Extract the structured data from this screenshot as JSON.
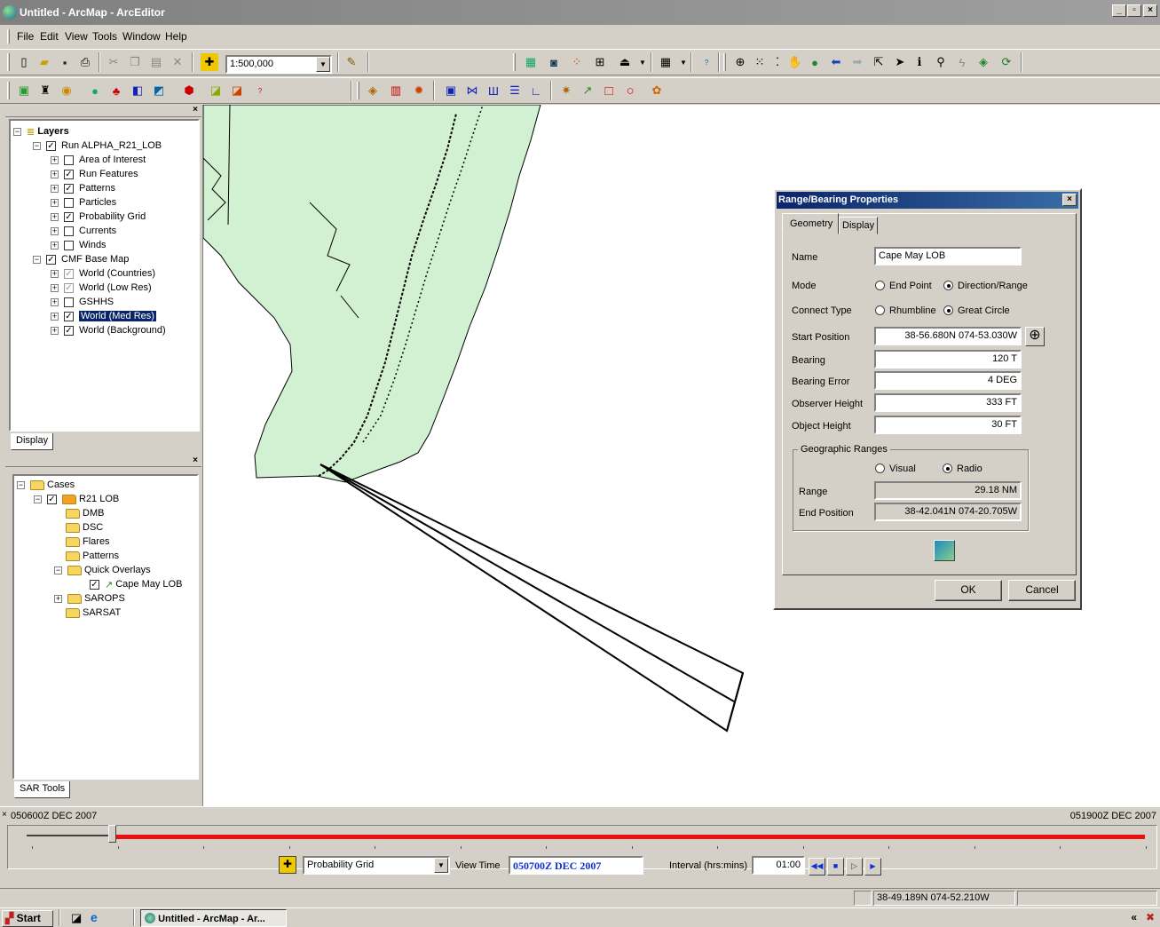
{
  "window": {
    "title": "Untitled - ArcMap - ArcEditor",
    "min": "_",
    "max": "▫",
    "close": "×"
  },
  "menu": [
    "File",
    "Edit",
    "View",
    "Tools",
    "Window",
    "Help"
  ],
  "toolbar": {
    "scale": "1:500,000"
  },
  "layers_panel": {
    "root": "Layers",
    "groups": [
      {
        "name": "Run ALPHA_R21_LOB",
        "checked": true,
        "items": [
          {
            "name": "Area of Interest",
            "checked": false
          },
          {
            "name": "Run Features",
            "checked": true
          },
          {
            "name": "Patterns",
            "checked": true
          },
          {
            "name": "Particles",
            "checked": false
          },
          {
            "name": "Probability Grid",
            "checked": true
          },
          {
            "name": "Currents",
            "checked": false
          },
          {
            "name": "Winds",
            "checked": false
          }
        ]
      },
      {
        "name": "CMF Base Map",
        "checked": true,
        "items": [
          {
            "name": "World (Countries)",
            "checked": "grey"
          },
          {
            "name": "World (Low Res)",
            "checked": "grey"
          },
          {
            "name": "GSHHS",
            "checked": false
          },
          {
            "name": "World (Med Res)",
            "checked": true,
            "selected": true
          },
          {
            "name": "World (Background)",
            "checked": true
          }
        ]
      }
    ],
    "tab": "Display"
  },
  "cases_panel": {
    "root": "Cases",
    "case": "R21 LOB",
    "children": [
      "DMB",
      "DSC",
      "Flares",
      "Patterns",
      "Quick Overlays",
      "SAROPS",
      "SARSAT"
    ],
    "overlay_item": "Cape May LOB",
    "tab": "SAR Tools"
  },
  "dialog": {
    "title": "Range/Bearing Properties",
    "tabs": [
      "Geometry",
      "Display"
    ],
    "name_label": "Name",
    "name_value": "Cape May LOB",
    "mode_label": "Mode",
    "mode_options": [
      "End Point",
      "Direction/Range"
    ],
    "connect_label": "Connect Type",
    "connect_options": [
      "Rhumbline",
      "Great Circle"
    ],
    "start_label": "Start Position",
    "start_value": "38-56.680N 074-53.030W",
    "bearing_label": "Bearing",
    "bearing_value": "120 T",
    "bearing_error_label": "Bearing Error",
    "bearing_error_value": "4 DEG",
    "observer_label": "Observer Height",
    "observer_value": "333 FT",
    "object_label": "Object Height",
    "object_value": "30 FT",
    "geo_group": "Geographic Ranges",
    "geo_options": [
      "Visual",
      "Radio"
    ],
    "range_label": "Range",
    "range_value": "29.18 NM",
    "end_label": "End Position",
    "end_value": "38-42.041N 074-20.705W",
    "ok": "OK",
    "cancel": "Cancel"
  },
  "timebar": {
    "start": "050600Z DEC 2007",
    "end": "051900Z DEC 2007",
    "layer": "Probability Grid",
    "view_time_label": "View Time",
    "view_time": "050700Z DEC 2007",
    "interval_label": "Interval (hrs:mins)",
    "interval": "01:00",
    "progress_fraction": 0.077
  },
  "status": {
    "coords": "38-49.189N 074-52.210W"
  },
  "taskbar": {
    "start": "Start",
    "task": "Untitled - ArcMap - Ar...",
    "tray": "«"
  }
}
